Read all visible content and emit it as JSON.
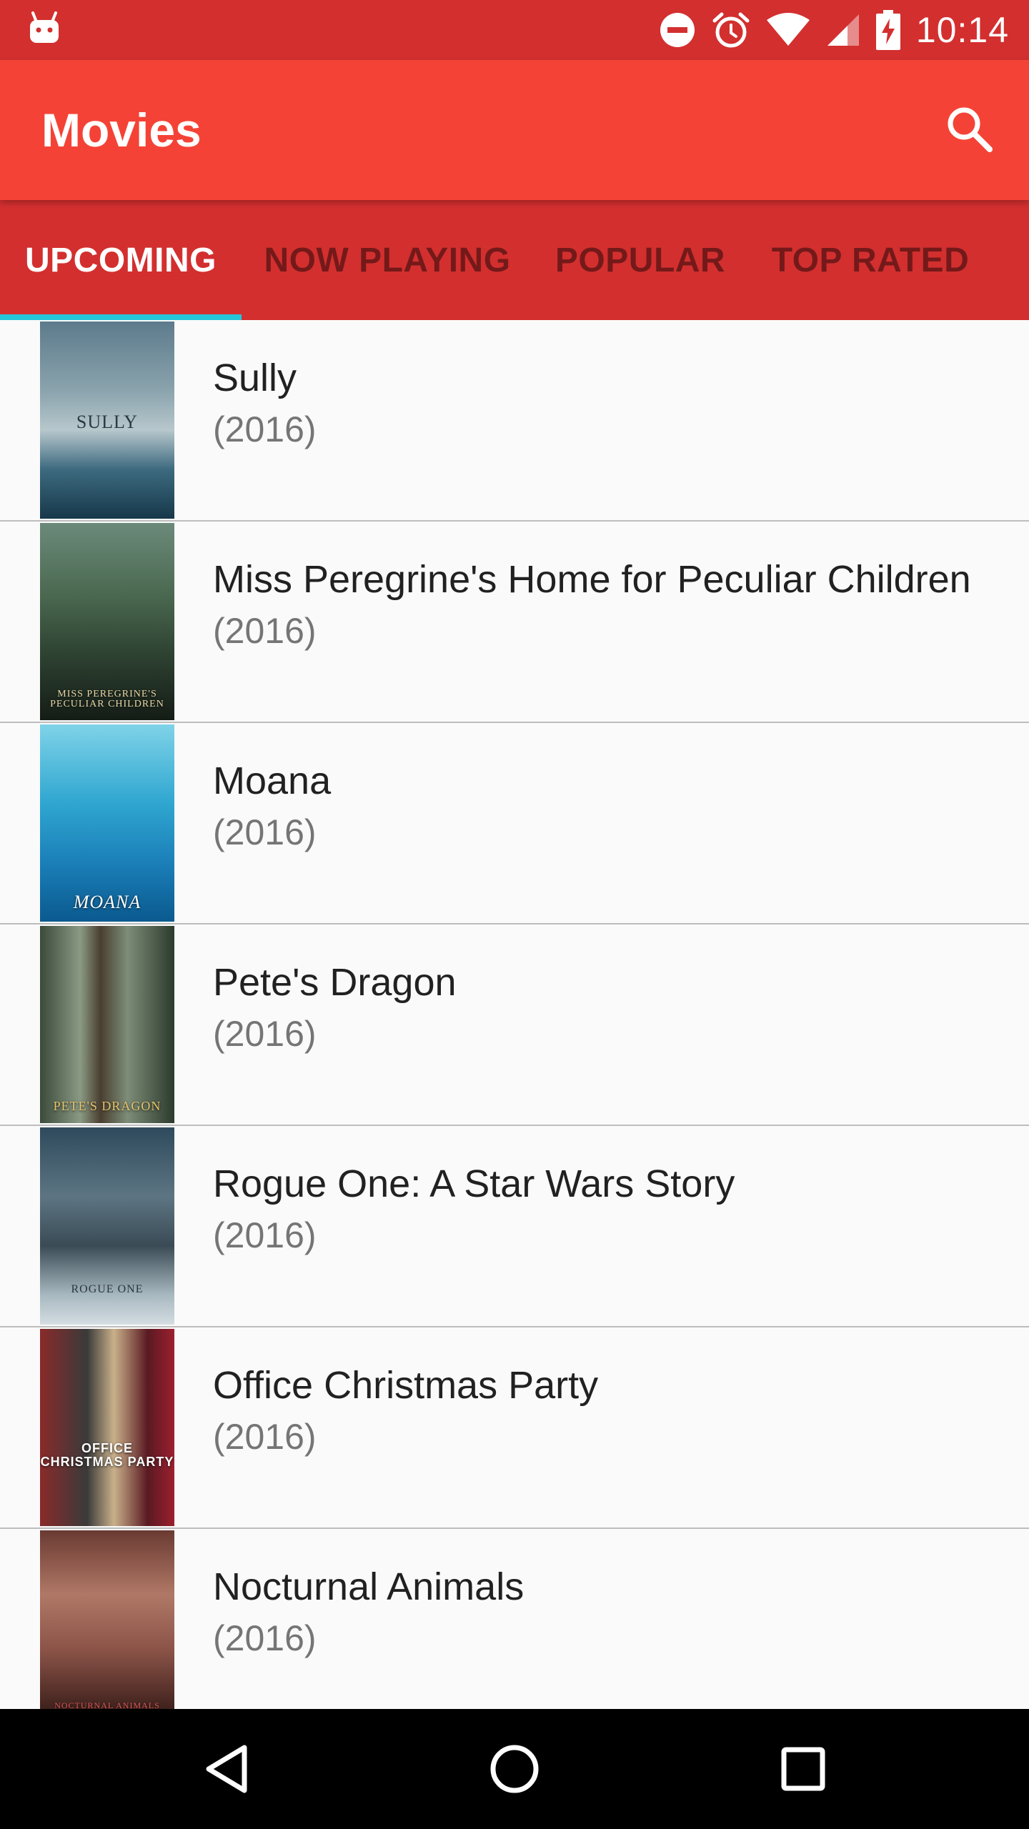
{
  "status_bar": {
    "time": "10:14",
    "icons": [
      "android-notification-icon",
      "do-not-disturb-icon",
      "alarm-icon",
      "wifi-icon",
      "cell-signal-icon",
      "battery-charging-icon"
    ]
  },
  "app_bar": {
    "title": "Movies",
    "search_icon": "search-icon"
  },
  "tabs": [
    {
      "label": "UPCOMING",
      "active": true
    },
    {
      "label": "NOW PLAYING",
      "active": false
    },
    {
      "label": "POPULAR",
      "active": false
    },
    {
      "label": "TOP RATED",
      "active": false
    }
  ],
  "movies": [
    {
      "title": "Sully",
      "year": "(2016)",
      "poster_caption": "SULLY"
    },
    {
      "title": "Miss Peregrine's Home for Peculiar Children",
      "year": "(2016)",
      "poster_caption": "MISS PEREGRINE'S PECULIAR CHILDREN"
    },
    {
      "title": "Moana",
      "year": "(2016)",
      "poster_caption": "MOANA"
    },
    {
      "title": "Pete's Dragon",
      "year": "(2016)",
      "poster_caption": "PETE'S DRAGON"
    },
    {
      "title": "Rogue One: A Star Wars Story",
      "year": "(2016)",
      "poster_caption": "ROGUE ONE"
    },
    {
      "title": "Office Christmas Party",
      "year": "(2016)",
      "poster_caption": "OFFICE CHRISTMAS PARTY"
    },
    {
      "title": "Nocturnal Animals",
      "year": "(2016)",
      "poster_caption": "NOCTURNAL ANIMALS"
    }
  ],
  "nav_bar": {
    "back_icon": "back-icon",
    "home_icon": "home-icon",
    "recents_icon": "recents-icon"
  },
  "colors": {
    "status_bar": "#d32f2f",
    "app_bar": "#f44336",
    "tab_bar": "#d32f2f",
    "tab_indicator": "#26c6da",
    "list_background": "#fafafa"
  }
}
